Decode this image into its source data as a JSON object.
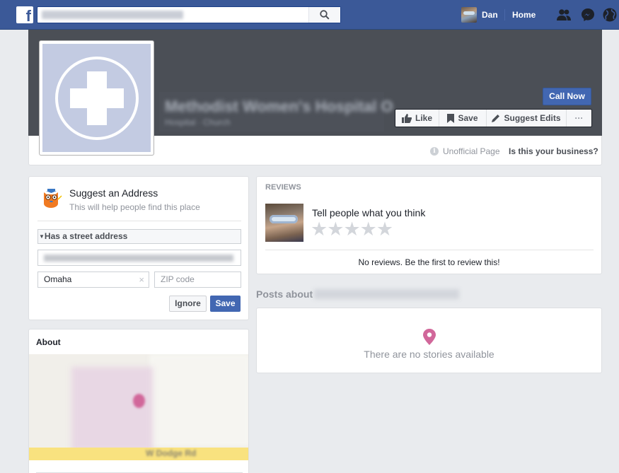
{
  "topbar": {
    "logo_letter": "f",
    "search_placeholder": "Methodist Women's Hospital O",
    "user_name": "Dan",
    "home_label": "Home",
    "icons": [
      "friends-icon",
      "messenger-icon",
      "globe-icon"
    ]
  },
  "page": {
    "name": "Methodist Women's Hospital O",
    "category": "Hospital · Church",
    "call_now_label": "Call Now",
    "actions": [
      {
        "label": "Like",
        "icon": "thumbs-up-icon"
      },
      {
        "label": "Save",
        "icon": "bookmark-icon"
      },
      {
        "label": "Suggest Edits",
        "icon": "pencil-icon"
      },
      {
        "label": "···",
        "icon": "more-icon"
      }
    ],
    "unofficial_label": "Unofficial Page",
    "business_link": "Is this your business?"
  },
  "suggest_address": {
    "title": "Suggest an Address",
    "subtitle": "This will help people find this place",
    "toggle_label": "Has a street address",
    "street_value": "707 North 190th Plaza Elkhorn, Nebraska, NE 68022",
    "city_value": "Omaha",
    "zip_placeholder": "ZIP code",
    "ignore_label": "Ignore",
    "save_label": "Save"
  },
  "about": {
    "title": "About",
    "map_road_label": "W Dodge Rd"
  },
  "reviews": {
    "header": "REVIEWS",
    "prompt": "Tell people what you think",
    "rating": 0,
    "max_rating": 5,
    "empty_text": "No reviews. Be the first to review this!"
  },
  "posts": {
    "header_prefix": "Posts about",
    "header_name": "Methodist Women's Hospital O",
    "empty_text": "There are no stories available"
  },
  "colors": {
    "brand": "#3b5998",
    "button_primary": "#4267b2",
    "pin": "#d1679a",
    "cover": "#4b4f56"
  }
}
